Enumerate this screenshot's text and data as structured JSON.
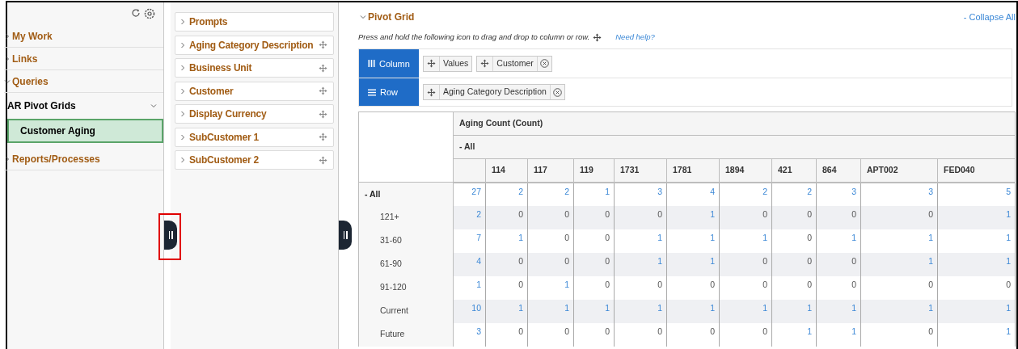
{
  "nav": {
    "items": [
      {
        "label": "My Work",
        "kind": "section",
        "expanded": false,
        "selected": false
      },
      {
        "label": "Links",
        "kind": "section",
        "expanded": false,
        "selected": false
      },
      {
        "label": "Queries",
        "kind": "section",
        "expanded": true,
        "selected": false
      },
      {
        "label": "AR Pivot Grids",
        "kind": "group",
        "expanded": true,
        "selected": false
      },
      {
        "label": "Customer Aging",
        "kind": "leaf",
        "selected": true
      },
      {
        "label": "Reports/Processes",
        "kind": "section",
        "expanded": false,
        "selected": false
      }
    ]
  },
  "fields": [
    {
      "label": "Prompts",
      "draggable": false
    },
    {
      "label": "Aging Category Description",
      "draggable": true
    },
    {
      "label": "Business Unit",
      "draggable": true
    },
    {
      "label": "Customer",
      "draggable": true
    },
    {
      "label": "Display Currency",
      "draggable": true
    },
    {
      "label": "SubCustomer 1",
      "draggable": true
    },
    {
      "label": "SubCustomer 2",
      "draggable": true
    }
  ],
  "pivot": {
    "title": "Pivot Grid",
    "collapse_link": "- Collapse All",
    "instructions": "Press and hold the following icon to drag and drop to column or row.",
    "help_link": "Need help?",
    "drop_zones": [
      {
        "label": "Column",
        "kind": "column",
        "chips": [
          {
            "label": "Values",
            "removable": false
          },
          {
            "label": "Customer",
            "removable": true
          }
        ]
      },
      {
        "label": "Row",
        "kind": "row",
        "chips": [
          {
            "label": "Aging Category Description",
            "removable": true
          }
        ]
      }
    ],
    "table": {
      "measure": "Aging Count (Count)",
      "column_total": "- All",
      "columns": [
        "",
        "114",
        "117",
        "119",
        "1731",
        "1781",
        "1894",
        "421",
        "864",
        "APT002",
        "FED040"
      ],
      "rows": [
        {
          "label": "- All",
          "total": true,
          "cells": [
            {
              "value": "27",
              "link": true
            },
            {
              "value": "2",
              "link": true
            },
            {
              "value": "2",
              "link": true
            },
            {
              "value": "1",
              "link": true
            },
            {
              "value": "3",
              "link": true
            },
            {
              "value": "4",
              "link": true
            },
            {
              "value": "2",
              "link": true
            },
            {
              "value": "2",
              "link": true
            },
            {
              "value": "3",
              "link": true
            },
            {
              "value": "3",
              "link": true
            },
            {
              "value": "5",
              "link": true
            }
          ]
        },
        {
          "label": "121+",
          "total": false,
          "cells": [
            {
              "value": "2",
              "link": true
            },
            {
              "value": "0",
              "link": false
            },
            {
              "value": "0",
              "link": false
            },
            {
              "value": "0",
              "link": false
            },
            {
              "value": "0",
              "link": false
            },
            {
              "value": "1",
              "link": true
            },
            {
              "value": "0",
              "link": false
            },
            {
              "value": "0",
              "link": false
            },
            {
              "value": "0",
              "link": false
            },
            {
              "value": "0",
              "link": false
            },
            {
              "value": "1",
              "link": true
            }
          ]
        },
        {
          "label": "31-60",
          "total": false,
          "cells": [
            {
              "value": "7",
              "link": true
            },
            {
              "value": "1",
              "link": true
            },
            {
              "value": "0",
              "link": false
            },
            {
              "value": "0",
              "link": false
            },
            {
              "value": "1",
              "link": true
            },
            {
              "value": "1",
              "link": true
            },
            {
              "value": "1",
              "link": true
            },
            {
              "value": "0",
              "link": false
            },
            {
              "value": "1",
              "link": true
            },
            {
              "value": "1",
              "link": true
            },
            {
              "value": "1",
              "link": true
            }
          ]
        },
        {
          "label": "61-90",
          "total": false,
          "cells": [
            {
              "value": "4",
              "link": true
            },
            {
              "value": "0",
              "link": false
            },
            {
              "value": "0",
              "link": false
            },
            {
              "value": "0",
              "link": false
            },
            {
              "value": "1",
              "link": true
            },
            {
              "value": "1",
              "link": true
            },
            {
              "value": "0",
              "link": false
            },
            {
              "value": "0",
              "link": false
            },
            {
              "value": "0",
              "link": false
            },
            {
              "value": "1",
              "link": true
            },
            {
              "value": "1",
              "link": true
            }
          ]
        },
        {
          "label": "91-120",
          "total": false,
          "cells": [
            {
              "value": "1",
              "link": true
            },
            {
              "value": "0",
              "link": false
            },
            {
              "value": "1",
              "link": true
            },
            {
              "value": "0",
              "link": false
            },
            {
              "value": "0",
              "link": false
            },
            {
              "value": "0",
              "link": false
            },
            {
              "value": "0",
              "link": false
            },
            {
              "value": "0",
              "link": false
            },
            {
              "value": "0",
              "link": false
            },
            {
              "value": "0",
              "link": false
            },
            {
              "value": "0",
              "link": false
            }
          ]
        },
        {
          "label": "Current",
          "total": false,
          "cells": [
            {
              "value": "10",
              "link": true
            },
            {
              "value": "1",
              "link": true
            },
            {
              "value": "1",
              "link": true
            },
            {
              "value": "1",
              "link": true
            },
            {
              "value": "1",
              "link": true
            },
            {
              "value": "1",
              "link": true
            },
            {
              "value": "1",
              "link": true
            },
            {
              "value": "1",
              "link": true
            },
            {
              "value": "1",
              "link": true
            },
            {
              "value": "1",
              "link": true
            },
            {
              "value": "1",
              "link": true
            }
          ]
        },
        {
          "label": "Future",
          "total": false,
          "cells": [
            {
              "value": "3",
              "link": true
            },
            {
              "value": "0",
              "link": false
            },
            {
              "value": "0",
              "link": false
            },
            {
              "value": "0",
              "link": false
            },
            {
              "value": "0",
              "link": false
            },
            {
              "value": "0",
              "link": false
            },
            {
              "value": "0",
              "link": false
            },
            {
              "value": "1",
              "link": true
            },
            {
              "value": "1",
              "link": true
            },
            {
              "value": "0",
              "link": false
            },
            {
              "value": "1",
              "link": true
            }
          ]
        }
      ]
    }
  },
  "highlight": {
    "on": true
  }
}
